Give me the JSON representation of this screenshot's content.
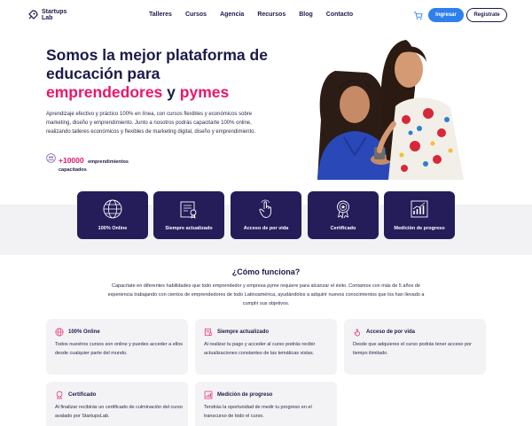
{
  "nav": {
    "logo_line1": "Startups",
    "logo_line2": "Lab",
    "items": [
      "Talleres",
      "Cursos",
      "Agencia",
      "Recursos",
      "Blog",
      "Contacto"
    ],
    "login": "Ingresar",
    "register": "Registrate"
  },
  "hero": {
    "title_1": "Somos la mejor plataforma de educación para ",
    "title_highlight_1": "emprendedores",
    "title_2": " y ",
    "title_highlight_2": "pymes",
    "description": "Aprendizaje efectivo y práctico 100% en línea, con cursos flexibles y económicos sobre marketing, diseño y emprendimiento. Junto a nosotros podrás capacitarte 100% online, realizando talleres económicos y flexibles de marketing digital, diseño y emprendimiento.",
    "stat_number": "+10000",
    "stat_label_1": "emprendimientos",
    "stat_label_2": "capacitados"
  },
  "features": [
    {
      "label": "100% Online",
      "icon": "world-icon"
    },
    {
      "label": "Siempre actualizado",
      "icon": "certificate-doc-icon"
    },
    {
      "label": "Acceso de por vida",
      "icon": "touch-icon"
    },
    {
      "label": "Certificado",
      "icon": "award-icon"
    },
    {
      "label": "Medición de progreso",
      "icon": "chart-icon"
    }
  ],
  "how": {
    "title": "¿Cómo funciona?",
    "description": "Capacítate en diferentes habilidades que todo emprendedor y empresa pyme requiere para alcanzar el éxito. Contamos con más de 5 años de experiencia trabajando con cientos de emprendedores de todo Latinoamérica, ayudándolos a adquirir nuevos conocimientos que los han llevado a cumplir sus objetivos.",
    "cards": [
      {
        "title": "100% Online",
        "text": "Todos nuestros cursos son online y puedes acceder a ellos desde cualquier parte del mundo."
      },
      {
        "title": "Siempre actualizado",
        "text": "Al realizar tu pago y acceder al curso podrás recibir actualizaciones constantes de las temáticas vistas."
      },
      {
        "title": "Acceso de por vida",
        "text": "Desde que adquieres el curso podrás tener acceso por tiempo ilimitado."
      },
      {
        "title": "Certificado",
        "text": "Al finalizar recibirás un certificado de culminación del curso avalado por StartupsLab."
      },
      {
        "title": "Medición de progreso",
        "text": "Tendrás la oportunidad de medir tu progreso en el transcurso de todo el curso."
      }
    ]
  },
  "colors": {
    "navy": "#241d5a",
    "pink": "#e8176c",
    "blue": "#2f80ed"
  }
}
